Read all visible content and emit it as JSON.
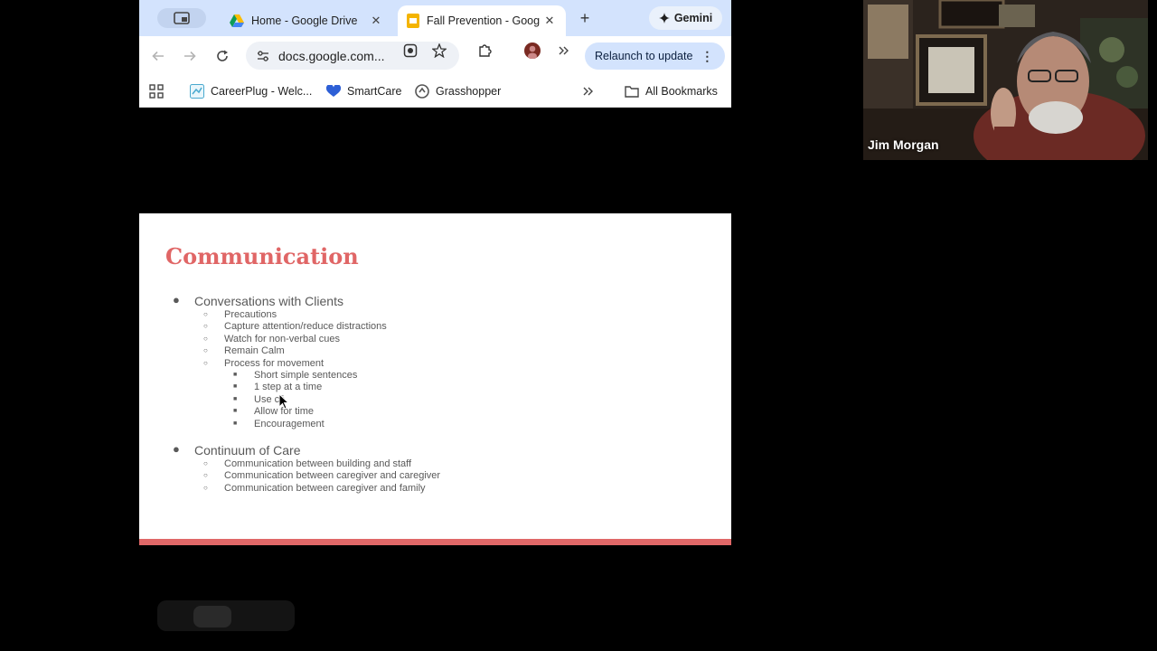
{
  "browser": {
    "tabs": [
      {
        "title": "Home - Google Drive",
        "active": false
      },
      {
        "title": "Fall Prevention - Goog",
        "active": true
      }
    ],
    "gemini_label": "Gemini",
    "url": "docs.google.com...",
    "relaunch_label": "Relaunch to update",
    "bookmarks": [
      {
        "label": "CareerPlug - Welc..."
      },
      {
        "label": "SmartCare"
      },
      {
        "label": "Grasshopper"
      }
    ],
    "all_bookmarks_label": "All Bookmarks"
  },
  "slide": {
    "title": "Communication",
    "sections": [
      {
        "heading": "Conversations with Clients",
        "items": [
          {
            "text": "Precautions"
          },
          {
            "text": "Capture attention/reduce distractions"
          },
          {
            "text": "Watch for non-verbal cues"
          },
          {
            "text": "Remain Calm"
          },
          {
            "text": "Process for movement",
            "subitems": [
              "Short simple sentences",
              "1 step at a time",
              "Use cē",
              "Allow for time",
              "Encouragement"
            ]
          }
        ]
      },
      {
        "heading": "Continuum of Care",
        "items": [
          {
            "text": "Communication between building and staff"
          },
          {
            "text": "Communication between caregiver and caregiver"
          },
          {
            "text": "Communication between caregiver and family"
          }
        ]
      }
    ],
    "accent_color": "#e06868",
    "title_color": "#e06666"
  },
  "participant": {
    "name": "Jim Morgan"
  }
}
